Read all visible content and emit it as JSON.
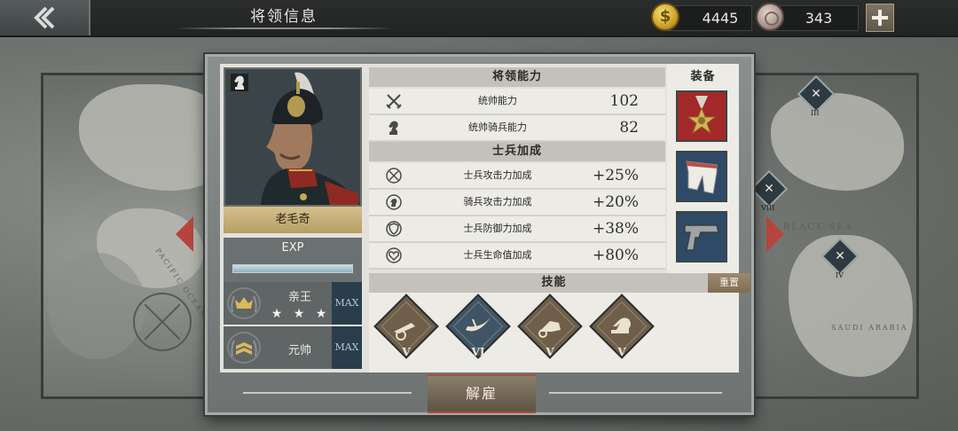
{
  "header": {
    "title": "将领信息"
  },
  "resources": {
    "gold": "4445",
    "medals": "343"
  },
  "general": {
    "name": "老毛奇",
    "exp_label": "EXP",
    "exp_fill": 1.0,
    "nobility": {
      "title": "亲王",
      "stars": "★ ★ ★",
      "max_label": "MAX"
    },
    "military_rank": {
      "title": "元帅",
      "max_label": "MAX"
    }
  },
  "ability": {
    "section_title": "将领能力",
    "stats": [
      {
        "label": "统帅能力",
        "value": "102",
        "icon": "crossed-swords-icon"
      },
      {
        "label": "统帅骑兵能力",
        "value": "82",
        "icon": "horse-head-icon"
      }
    ]
  },
  "soldier_bonus": {
    "section_title": "士兵加成",
    "stats": [
      {
        "label": "士兵攻击力加成",
        "value": "+25%",
        "icon": "attack-up-icon"
      },
      {
        "label": "骑兵攻击力加成",
        "value": "+20%",
        "icon": "cavalry-attack-icon"
      },
      {
        "label": "士兵防御力加成",
        "value": "+38%",
        "icon": "shield-up-icon"
      },
      {
        "label": "士兵生命值加成",
        "value": "+80%",
        "icon": "heart-up-icon"
      }
    ]
  },
  "equipment": {
    "section_title": "装备",
    "slots": [
      {
        "name": "medal-item-icon",
        "color": "#a3282a"
      },
      {
        "name": "trousers-item-icon",
        "color": "#2e4a66"
      },
      {
        "name": "pistol-item-icon",
        "color": "#2e4a66"
      }
    ]
  },
  "skills": {
    "section_title": "技能",
    "reset_label": "重置",
    "list": [
      {
        "icon": "artillery-skill-icon",
        "level": "V",
        "color": "#6f5e49"
      },
      {
        "icon": "cavalry-charge-skill-icon",
        "level": "VI",
        "color": "#3f5565"
      },
      {
        "icon": "chariot-skill-icon",
        "level": "V",
        "color": "#6f5e49"
      },
      {
        "icon": "horse-skill-icon",
        "level": "V",
        "color": "#6f5e49"
      }
    ]
  },
  "footer": {
    "dismiss_label": "解雇"
  },
  "map": {
    "labels": [
      "BLACK SEA",
      "SAUDI ARABIA",
      "PACIFIC OCEAN"
    ],
    "markers": [
      "III",
      "VIII",
      "IV"
    ]
  }
}
